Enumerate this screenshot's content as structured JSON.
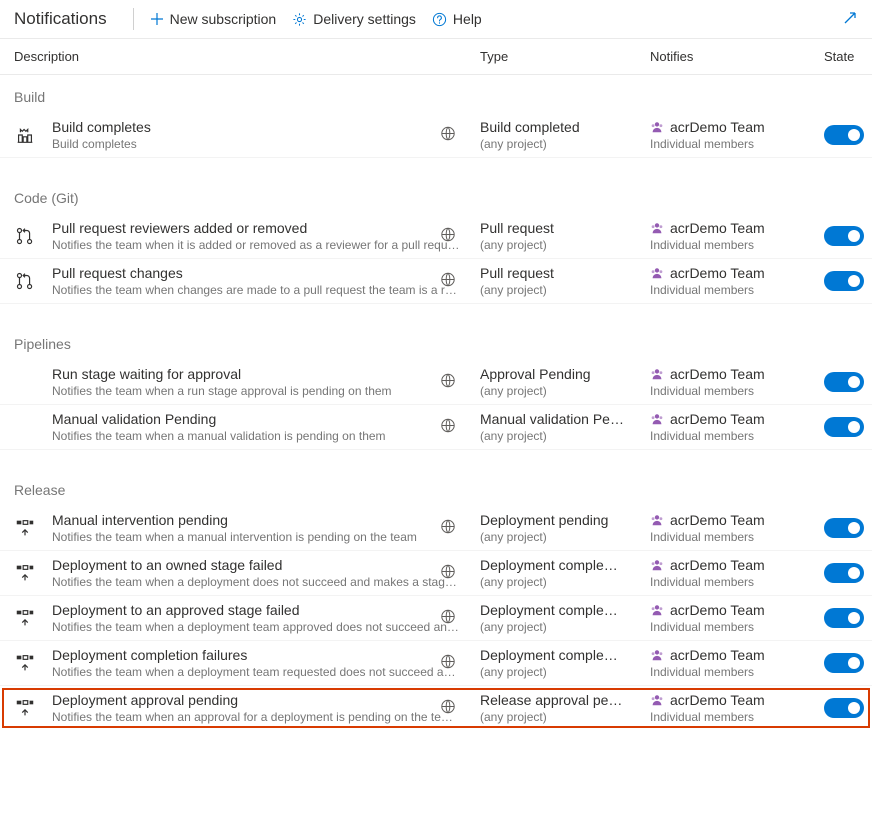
{
  "header": {
    "title": "Notifications",
    "new_subscription": "New subscription",
    "delivery_settings": "Delivery settings",
    "help": "Help"
  },
  "columns": {
    "description": "Description",
    "type": "Type",
    "notifies": "Notifies",
    "state": "State"
  },
  "team": {
    "name": "acrDemo Team",
    "members": "Individual members"
  },
  "any_project": "(any project)",
  "sections": [
    {
      "title": "Build",
      "rows": [
        {
          "icon": "build",
          "title": "Build completes",
          "subtitle": "Build completes",
          "type": "Build completed",
          "highlighted": false
        }
      ]
    },
    {
      "title": "Code (Git)",
      "rows": [
        {
          "icon": "pullrequest",
          "title": "Pull request reviewers added or removed",
          "subtitle": "Notifies the team when it is added or removed as a reviewer for a pull requ…",
          "type": "Pull request",
          "highlighted": false
        },
        {
          "icon": "pullrequest",
          "title": "Pull request changes",
          "subtitle": "Notifies the team when changes are made to a pull request the team is a r…",
          "type": "Pull request",
          "highlighted": false
        }
      ]
    },
    {
      "title": "Pipelines",
      "rows": [
        {
          "icon": "",
          "title": "Run stage waiting for approval",
          "subtitle": "Notifies the team when a run stage approval is pending on them",
          "type": "Approval Pending",
          "highlighted": false
        },
        {
          "icon": "",
          "title": "Manual validation Pending",
          "subtitle": "Notifies the team when a manual validation is pending on them",
          "type": "Manual validation Pe…",
          "highlighted": false
        }
      ]
    },
    {
      "title": "Release",
      "rows": [
        {
          "icon": "release",
          "title": "Manual intervention pending",
          "subtitle": "Notifies the team when a manual intervention is pending on the team",
          "type": "Deployment pending",
          "highlighted": false
        },
        {
          "icon": "release",
          "title": "Deployment to an owned stage failed",
          "subtitle": "Notifies the team when a deployment does not succeed and makes a stag…",
          "type": "Deployment comple…",
          "highlighted": false
        },
        {
          "icon": "release",
          "title": "Deployment to an approved stage failed",
          "subtitle": "Notifies the team when a deployment team approved does not succeed an…",
          "type": "Deployment comple…",
          "highlighted": false
        },
        {
          "icon": "release",
          "title": "Deployment completion failures",
          "subtitle": "Notifies the team when a deployment team requested does not succeed a…",
          "type": "Deployment comple…",
          "highlighted": false
        },
        {
          "icon": "release",
          "title": "Deployment approval pending",
          "subtitle": "Notifies the team when an approval for a deployment is pending on the te…",
          "type": "Release approval pe…",
          "highlighted": true
        }
      ]
    }
  ]
}
